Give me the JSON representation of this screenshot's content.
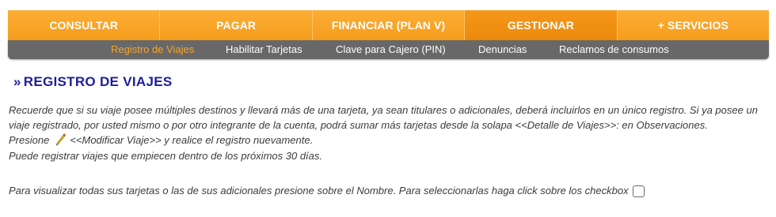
{
  "nav": {
    "items": [
      "CONSULTAR",
      "PAGAR",
      "FINANCIAR (PLAN V)",
      "GESTIONAR",
      "+ SERVICIOS"
    ],
    "active": "GESTIONAR"
  },
  "subnav": {
    "items": [
      "Registro de Viajes",
      "Habilitar Tarjetas",
      "Clave para Cajero (PIN)",
      "Denuncias",
      "Reclamos de consumos"
    ],
    "active": "Registro de Viajes"
  },
  "page": {
    "title_marker": "»",
    "title": "REGISTRO DE VIAJES"
  },
  "info": {
    "line1": "Recuerde que si su viaje posee múltiples destinos y llevará más de una tarjeta, ya sean titulares o adicionales, deberá incluirlos en un único registro. Si ya posee un",
    "line2": "viaje registrado, por usted mismo o por otro integrante de la cuenta, podrá sumar más tarjetas desde la solapa <<Detalle de Viajes>>: en Observaciones.",
    "line3_pre": "Presione",
    "line3_post": "<<Modificar Viaje>> y realice el registro nuevamente.",
    "line4": "Puede registrar viajes que empiecen dentro de los próximos 30 días.",
    "line5": "Para visualizar todas sus tarjetas o las de sus adicionales presione sobre el Nombre. Para seleccionarlas haga click sobre los checkbox"
  },
  "icons": {
    "edit": "pencil-icon",
    "select_all": "checkbox"
  },
  "colors": {
    "nav_orange": "#f8a62a",
    "subnav_gray": "#686868",
    "active_sub": "#f7a52d",
    "title_blue": "#1e1e9c"
  }
}
